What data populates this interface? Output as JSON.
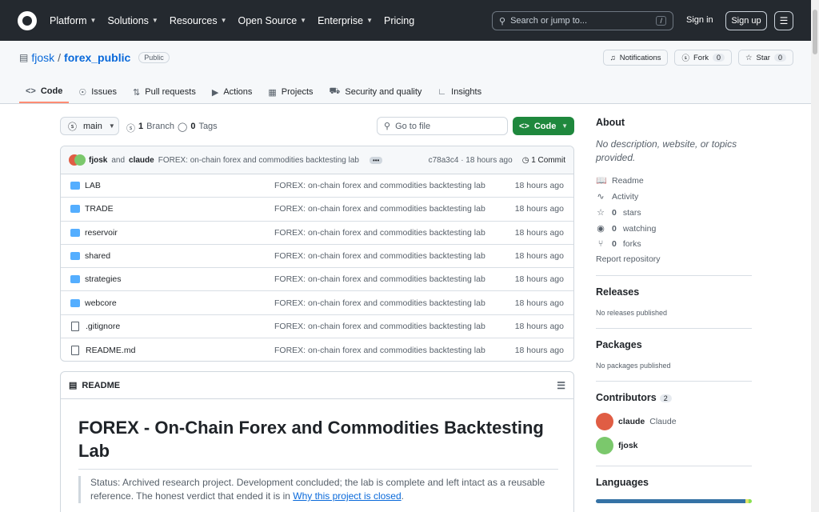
{
  "topnav": {
    "items": [
      "Platform",
      "Solutions",
      "Resources",
      "Open Source",
      "Enterprise",
      "Pricing"
    ],
    "search_placeholder": "Search or jump to...",
    "slash_key": "/",
    "signin": "Sign in",
    "signup": "Sign up"
  },
  "repo": {
    "owner": "fjosk",
    "separator": "/",
    "name": "forex_public",
    "visibility": "Public",
    "notifications_label": "Notifications",
    "fork_label": "Fork",
    "fork_count": "0",
    "star_label": "Star",
    "star_count": "0"
  },
  "tabs": [
    {
      "label": "Code",
      "icon": "code-icon"
    },
    {
      "label": "Issues",
      "icon": "issue-icon"
    },
    {
      "label": "Pull requests",
      "icon": "pull-request-icon"
    },
    {
      "label": "Actions",
      "icon": "play-icon"
    },
    {
      "label": "Projects",
      "icon": "table-icon"
    },
    {
      "label": "Security and quality",
      "icon": "shield-icon"
    },
    {
      "label": "Insights",
      "icon": "graph-icon"
    }
  ],
  "branchbar": {
    "branch": "main",
    "branch_count": "1",
    "branch_label": "Branch",
    "tag_count": "0",
    "tag_label": "Tags",
    "goto_placeholder": "Go to file",
    "code_button": "Code"
  },
  "commit": {
    "author1": "fjosk",
    "and": "and",
    "author2": "claude",
    "message": "FOREX: on-chain forex and commodities backtesting lab",
    "ellipsis": "•••",
    "hash": "c78a3c4 · 18 hours ago",
    "count": "1 Commit"
  },
  "files": [
    {
      "name": "LAB",
      "type": "folder",
      "message": "FOREX: on-chain forex and commodities backtesting lab",
      "age": "18 hours ago"
    },
    {
      "name": "TRADE",
      "type": "folder",
      "message": "FOREX: on-chain forex and commodities backtesting lab",
      "age": "18 hours ago"
    },
    {
      "name": "reservoir",
      "type": "folder",
      "message": "FOREX: on-chain forex and commodities backtesting lab",
      "age": "18 hours ago"
    },
    {
      "name": "shared",
      "type": "folder",
      "message": "FOREX: on-chain forex and commodities backtesting lab",
      "age": "18 hours ago"
    },
    {
      "name": "strategies",
      "type": "folder",
      "message": "FOREX: on-chain forex and commodities backtesting lab",
      "age": "18 hours ago"
    },
    {
      "name": "webcore",
      "type": "folder",
      "message": "FOREX: on-chain forex and commodities backtesting lab",
      "age": "18 hours ago"
    },
    {
      "name": ".gitignore",
      "type": "file",
      "message": "FOREX: on-chain forex and commodities backtesting lab",
      "age": "18 hours ago"
    },
    {
      "name": "README.md",
      "type": "file",
      "message": "FOREX: on-chain forex and commodities backtesting lab",
      "age": "18 hours ago"
    }
  ],
  "readme": {
    "tab_label": "README",
    "title": "FOREX - On-Chain Forex and Commodities Backtesting Lab",
    "quote_text": "Status: Archived research project. Development concluded; the lab is complete and left intact as a reusable reference. The honest verdict that ended it is in ",
    "quote_link": "Why this project is closed",
    "quote_end": "."
  },
  "sidebar": {
    "about_title": "About",
    "about_desc": "No description, website, or topics provided.",
    "links": [
      {
        "icon": "book-icon",
        "glyph": "📖",
        "count": "",
        "label": "Readme"
      },
      {
        "icon": "pulse-icon",
        "glyph": "∿",
        "count": "",
        "label": "Activity"
      },
      {
        "icon": "star-icon",
        "glyph": "☆",
        "count": "0",
        "label": "stars"
      },
      {
        "icon": "eye-icon",
        "glyph": "◉",
        "count": "0",
        "label": "watching"
      },
      {
        "icon": "fork-icon",
        "glyph": "⑂",
        "count": "0",
        "label": "forks"
      }
    ],
    "report": "Report repository",
    "releases_title": "Releases",
    "releases_text": "No releases published",
    "packages_title": "Packages",
    "packages_text": "No packages published",
    "contributors_title": "Contributors",
    "contributors_count": "2",
    "contributors": [
      {
        "login": "claude",
        "name": "Claude"
      },
      {
        "login": "fjosk",
        "name": ""
      }
    ],
    "languages_title": "Languages"
  },
  "colors": {
    "nav_bg": "#24292f",
    "link": "#0969da",
    "green": "#1f883d",
    "tab_underline": "#fd8c73",
    "folder": "#54aeff"
  }
}
